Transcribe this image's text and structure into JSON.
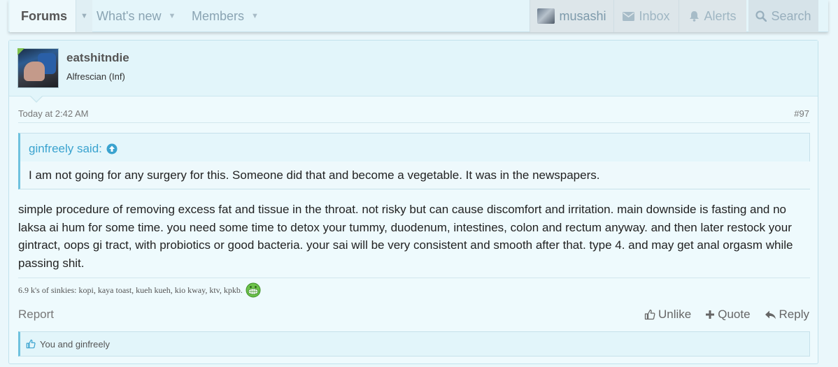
{
  "nav": {
    "forums": "Forums",
    "whats_new": "What's new",
    "members": "Members",
    "username": "musashi",
    "inbox": "Inbox",
    "alerts": "Alerts",
    "search": "Search"
  },
  "post": {
    "author": "eatshitndie",
    "author_title": "Alfrescian (Inf)",
    "date": "Today at 2:42 AM",
    "number": "#97",
    "quote": {
      "author": "ginfreely said:",
      "text": "I am not going for any surgery for this. Someone did that and become a vegetable. It was in the newspapers."
    },
    "body": "simple procedure of removing excess fat and tissue in the throat. not risky but can cause discomfort and irritation. main downside is fasting and no laksa ai hum for some time. you need some time to detox your tummy, duodenum, intestines, colon and rectum anyway. and then later restock your gintract, oops gi tract, with probiotics or good bacteria. your sai will be very consistent and smooth after that. type 4. and may get anal orgasm while passing shit.",
    "signature": "6.9 k's of sinkies: kopi, kaya toast, kueh kueh, kio kway, ktv, kpkb.",
    "actions": {
      "report": "Report",
      "unlike": "Unlike",
      "quote": "Quote",
      "reply": "Reply"
    },
    "likes": "You and ginfreely"
  },
  "colors": {
    "link": "#3aa3cf",
    "accent_border": "#6fc2de",
    "online": "#7ec14c"
  }
}
